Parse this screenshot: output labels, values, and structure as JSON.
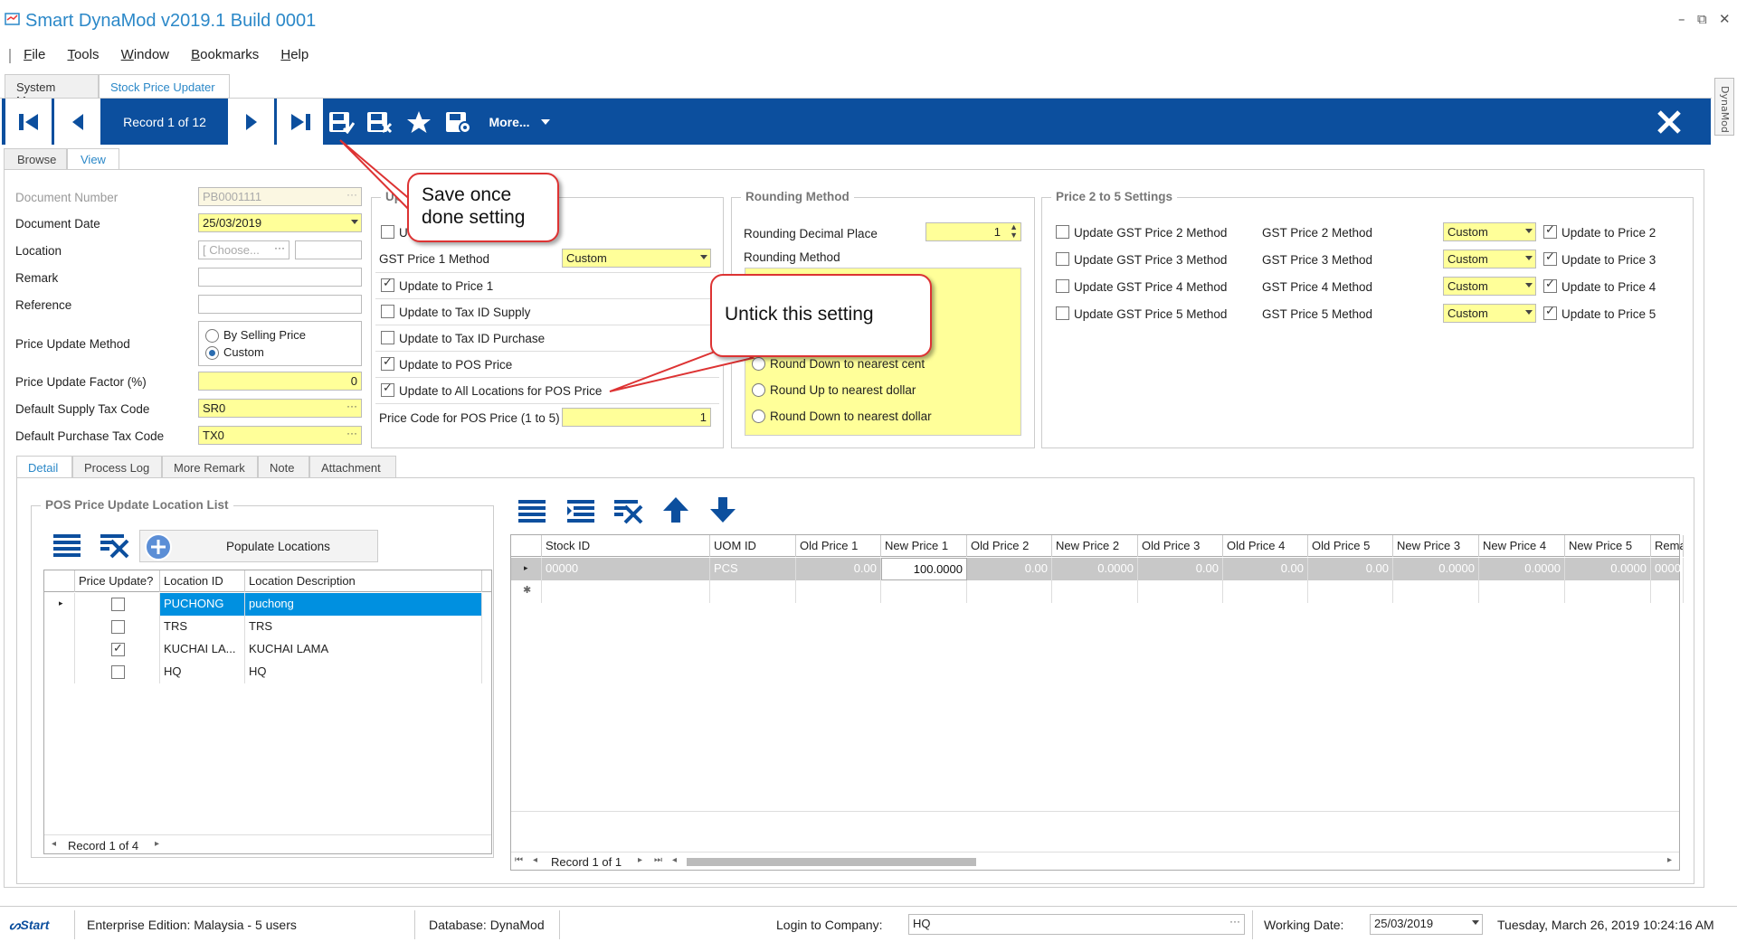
{
  "app": {
    "title": "Smart DynaMod v2019.1 Build 0001"
  },
  "menu": [
    "File",
    "Tools",
    "Window",
    "Bookmarks",
    "Help"
  ],
  "doc_tabs": [
    "System Menu",
    "Stock Price Updater"
  ],
  "side_tab": "DynaMod",
  "toolbar": {
    "record": "Record 1 of 12",
    "more": "More..."
  },
  "view_tabs": [
    "Browse",
    "View"
  ],
  "form": {
    "doc_number_label": "Document Number",
    "doc_number": "PB0001111",
    "doc_date_label": "Document Date",
    "doc_date": "25/03/2019",
    "location_label": "Location",
    "location_placeholder": "[ Choose...",
    "remark_label": "Remark",
    "reference_label": "Reference",
    "method_label": "Price Update Method",
    "method_opt1": "By Selling Price",
    "method_opt2": "Custom",
    "factor_label": "Price Update Factor (%)",
    "factor": "0",
    "supply_tax_label": "Default Supply Tax Code",
    "supply_tax": "SR0",
    "purchase_tax_label": "Default Purchase Tax Code",
    "purchase_tax": "TX0"
  },
  "update": {
    "title": "Up",
    "first_cb": "U",
    "gst1_label": "GST Price 1 Method",
    "gst1": "Custom",
    "cb_price1": "Update to Price 1",
    "cb_tax_supply": "Update to Tax ID Supply",
    "cb_tax_purchase": "Update to Tax ID Purchase",
    "cb_pos": "Update to POS Price",
    "cb_all_loc": "Update to All Locations for POS Price",
    "price_code_label": "Price Code for POS Price (1 to 5)",
    "price_code": "1"
  },
  "rounding": {
    "title": "Rounding Method",
    "decimal_label": "Rounding Decimal Place",
    "decimal": "1",
    "method_label": "Rounding Method",
    "opt_down_cent": "Round Down to nearest cent",
    "opt_up_dollar": "Round Up to nearest dollar",
    "opt_down_dollar": "Round Down to nearest dollar"
  },
  "price25": {
    "title": "Price 2 to 5 Settings",
    "rows": [
      {
        "cb": "Update GST Price 2 Method",
        "label": "GST Price 2 Method",
        "value": "Custom",
        "upd": "Update to Price 2"
      },
      {
        "cb": "Update GST Price 3 Method",
        "label": "GST Price 3 Method",
        "value": "Custom",
        "upd": "Update to Price 3"
      },
      {
        "cb": "Update GST Price 4 Method",
        "label": "GST Price 4 Method",
        "value": "Custom",
        "upd": "Update to Price 4"
      },
      {
        "cb": "Update GST Price 5 Method",
        "label": "GST Price 5 Method",
        "value": "Custom",
        "upd": "Update to Price 5"
      }
    ]
  },
  "lower_tabs": [
    "Detail",
    "Process Log",
    "More Remark",
    "Note",
    "Attachment"
  ],
  "loc_list": {
    "title": "POS Price Update Location List",
    "populate": "Populate Locations",
    "headers": [
      "Price Update?",
      "Location ID",
      "Location Description"
    ],
    "rows": [
      {
        "checked": false,
        "id": "PUCHONG",
        "desc": "puchong"
      },
      {
        "checked": false,
        "id": "TRS",
        "desc": "TRS"
      },
      {
        "checked": true,
        "id": "KUCHAI LA...",
        "desc": "KUCHAI LAMA"
      },
      {
        "checked": false,
        "id": "HQ",
        "desc": "HQ"
      }
    ],
    "record": "Record 1 of 4"
  },
  "detail": {
    "headers": [
      "Stock ID",
      "UOM ID",
      "Old Price 1",
      "New Price 1",
      "Old Price 2",
      "New Price 2",
      "Old Price 3",
      "Old Price 4",
      "Old Price 5",
      "New Price 3",
      "New Price 4",
      "New Price 5",
      "Rema"
    ],
    "row": [
      "00000",
      "PCS",
      "0.00",
      "100.0000",
      "0.00",
      "0.0000",
      "0.00",
      "0.00",
      "0.00",
      "0.0000",
      "0.0000",
      "0.0000",
      "0000"
    ],
    "record": "Record 1 of 1"
  },
  "status": {
    "brand": "Start",
    "edition": "Enterprise Edition: Malaysia - 5 users",
    "database": "Database: DynaMod",
    "login_label": "Login to Company:",
    "company": "HQ",
    "working_label": "Working Date:",
    "working_date": "25/03/2019",
    "datetime": "Tuesday, March 26, 2019 10:24:16 AM"
  },
  "callouts": {
    "save": "Save once done setting",
    "untick": "Untick this setting"
  }
}
